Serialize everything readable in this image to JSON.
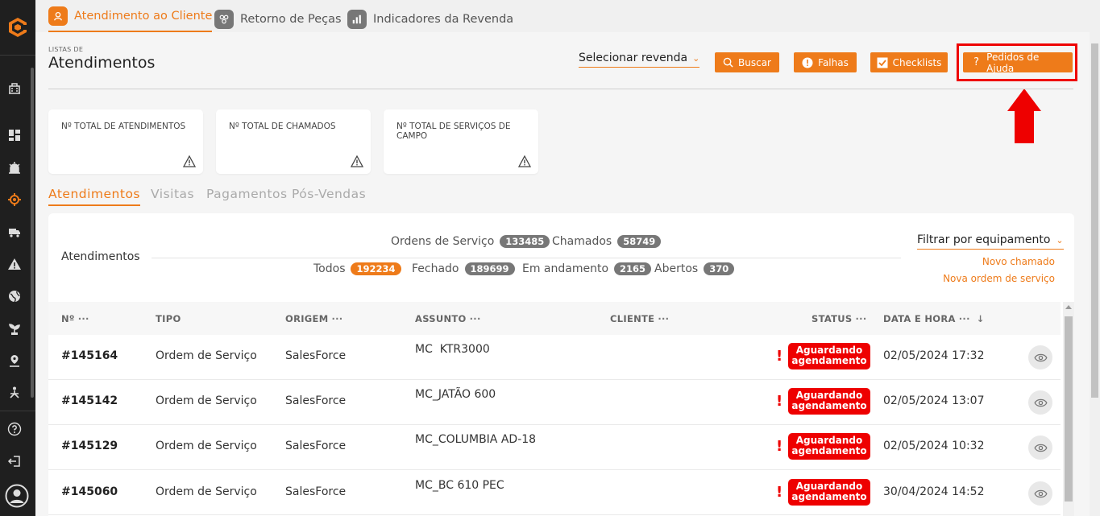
{
  "top_tabs": [
    {
      "label": "Atendimento ao Cliente"
    },
    {
      "label": "Retorno de Peças"
    },
    {
      "label": "Indicadores da Revenda"
    }
  ],
  "header": {
    "small_label": "LISTAS DE",
    "title": "Atendimentos",
    "select_revenda": "Selecionar revenda",
    "buttons": {
      "buscar": "Buscar",
      "falhas": "Falhas",
      "checklists": "Checklists",
      "pedidos_ajuda": "Pedidos de Ajuda"
    }
  },
  "cards": [
    {
      "label": "Nº TOTAL DE ATENDIMENTOS"
    },
    {
      "label": "Nº TOTAL DE CHAMADOS"
    },
    {
      "label": "Nº TOTAL DE SERVIÇOS DE CAMPO"
    }
  ],
  "sub_tabs": [
    "Atendimentos",
    "Visitas",
    "Pagamentos Pós-Vendas"
  ],
  "panel": {
    "title": "Atendimentos",
    "stats_top": [
      {
        "label": "Ordens de Serviço",
        "count": "133485"
      },
      {
        "label": "Chamados",
        "count": "58749"
      }
    ],
    "stats_bottom": [
      {
        "label": "Todos",
        "count": "192234"
      },
      {
        "label": "Fechado",
        "count": "189699"
      },
      {
        "label": "Em andamento",
        "count": "2165"
      },
      {
        "label": "Abertos",
        "count": "370"
      }
    ],
    "filter_label": "Filtrar por equipamento",
    "links": {
      "novo_chamado": "Novo chamado",
      "nova_os": "Nova ordem de serviço"
    }
  },
  "table": {
    "headers": {
      "numero": "Nº",
      "tipo": "TIPO",
      "origem": "ORIGEM",
      "assunto": "ASSUNTO",
      "cliente": "CLIENTE",
      "status": "STATUS",
      "data_hora": "DATA E HORA",
      "dots": "···"
    },
    "rows": [
      {
        "numero": "#145164",
        "tipo": "Ordem de Serviço",
        "origem": "SalesForce",
        "assunto": "MC  KTR3000",
        "status_l1": "Aguardando",
        "status_l2": "agendamento",
        "data_hora": "02/05/2024 17:32"
      },
      {
        "numero": "#145142",
        "tipo": "Ordem de Serviço",
        "origem": "SalesForce",
        "assunto": "MC_JATÃO 600",
        "status_l1": "Aguardando",
        "status_l2": "agendamento",
        "data_hora": "02/05/2024 13:07"
      },
      {
        "numero": "#145129",
        "tipo": "Ordem de Serviço",
        "origem": "SalesForce",
        "assunto": "MC_COLUMBIA AD-18",
        "status_l1": "Aguardando",
        "status_l2": "agendamento",
        "data_hora": "02/05/2024 10:32"
      },
      {
        "numero": "#145060",
        "tipo": "Ordem de Serviço",
        "origem": "SalesForce",
        "assunto": "MC_BC 610 PEC",
        "status_l1": "Aguardando",
        "status_l2": "agendamento",
        "data_hora": "30/04/2024 14:52"
      }
    ]
  },
  "colors": {
    "accent": "#ee7b1a",
    "status_red": "#ee0000",
    "sidebar_bg": "#1f1f1f"
  }
}
